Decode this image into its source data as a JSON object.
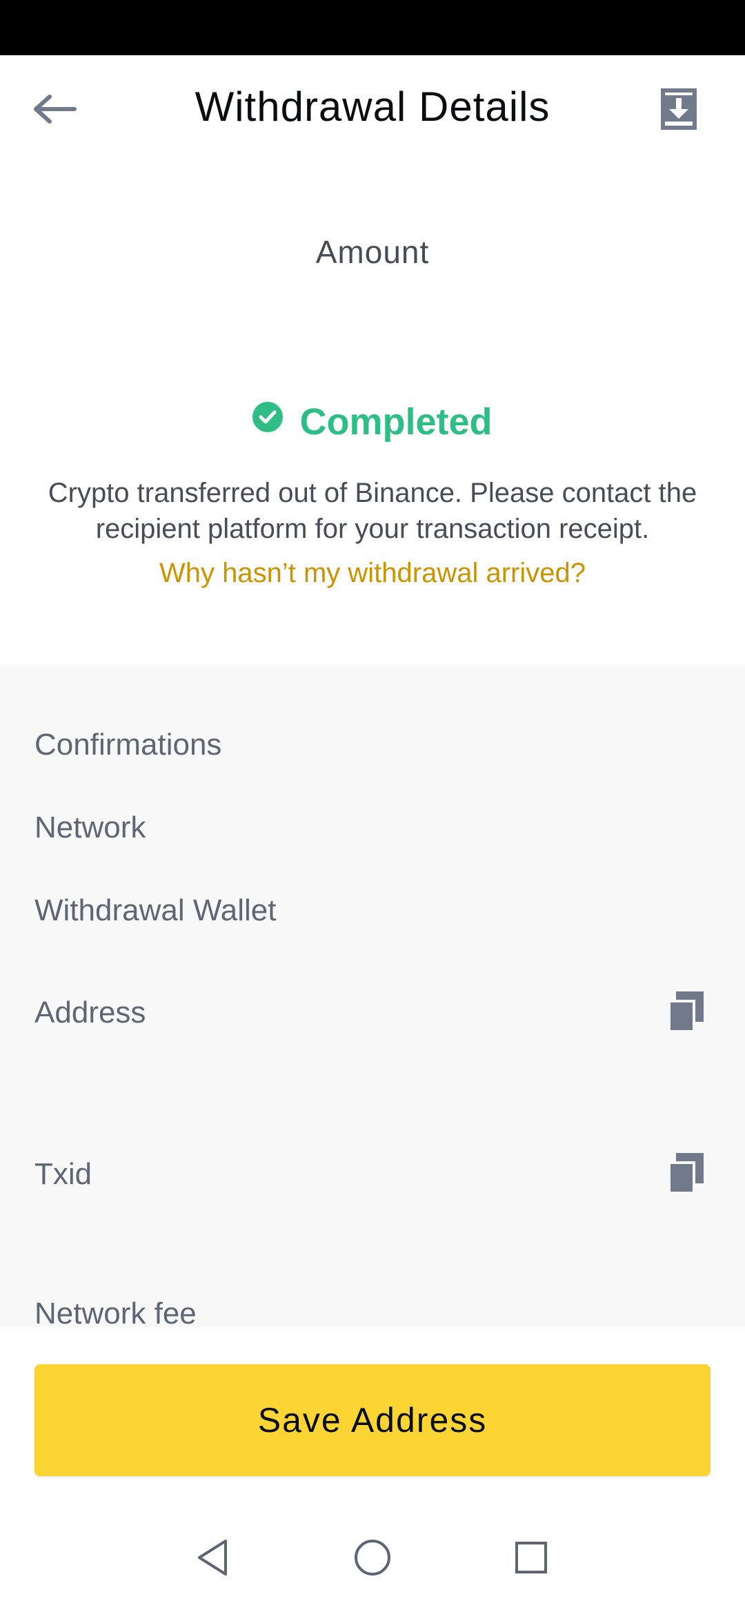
{
  "header": {
    "title": "Withdrawal Details",
    "back_icon": "arrow-left-icon",
    "download_icon": "download-icon"
  },
  "summary": {
    "amount_label": "Amount",
    "status": "Completed",
    "status_color": "#2ebd85",
    "description": "Crypto transferred out of Binance. Please contact the recipient platform for your transaction receipt.",
    "help_link": "Why hasn’t my withdrawal arrived?",
    "help_link_color": "#c99400"
  },
  "details": {
    "rows": [
      {
        "label": "Confirmations"
      },
      {
        "label": "Network"
      },
      {
        "label": "Withdrawal Wallet"
      },
      {
        "label": "Address",
        "copyable": true
      },
      {
        "label": "Txid",
        "copyable": true
      },
      {
        "label": "Network fee"
      }
    ]
  },
  "actions": {
    "save_label": "Save Address",
    "accent": "#fcd535"
  },
  "nav": {
    "back_icon": "triangle-back-icon",
    "home_icon": "circle-home-icon",
    "recents_icon": "square-recents-icon"
  }
}
